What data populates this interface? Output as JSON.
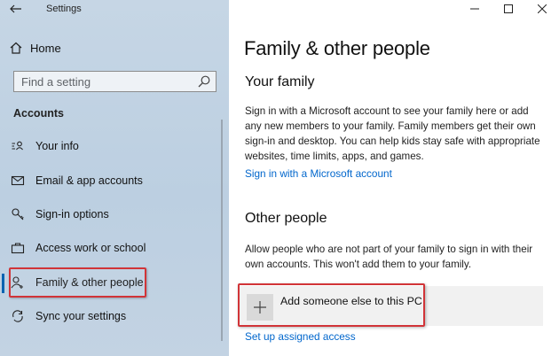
{
  "window": {
    "title": "Settings",
    "controls": [
      "minimize-icon",
      "maximize-icon",
      "close-icon"
    ]
  },
  "sidebar": {
    "home_label": "Home",
    "search_placeholder": "Find a setting",
    "section_title": "Accounts",
    "items": [
      {
        "label": "Your info",
        "icon": "person-card-icon",
        "selected": false
      },
      {
        "label": "Email & app accounts",
        "icon": "mail-icon",
        "selected": false
      },
      {
        "label": "Sign-in options",
        "icon": "key-icon",
        "selected": false
      },
      {
        "label": "Access work or school",
        "icon": "briefcase-icon",
        "selected": false
      },
      {
        "label": "Family & other people",
        "icon": "person-add-icon",
        "selected": true
      },
      {
        "label": "Sync your settings",
        "icon": "sync-icon",
        "selected": false
      }
    ]
  },
  "main": {
    "title": "Family & other people",
    "family": {
      "heading": "Your family",
      "description": "Sign in with a Microsoft account to see your family here or add any new members to your family. Family members get their own sign-in and desktop. You can help kids stay safe with appropriate websites, time limits, apps, and games.",
      "link": "Sign in with a Microsoft account"
    },
    "other": {
      "heading": "Other people",
      "description": "Allow people who are not part of your family to sign in with their own accounts. This won't add them to your family.",
      "add_label": "Add someone else to this PC",
      "link": "Set up assigned access"
    }
  },
  "colors": {
    "accent": "#0063b1",
    "link": "#0066cc",
    "highlight": "#d13438",
    "sidebar_bg": "#c2d3e3"
  }
}
